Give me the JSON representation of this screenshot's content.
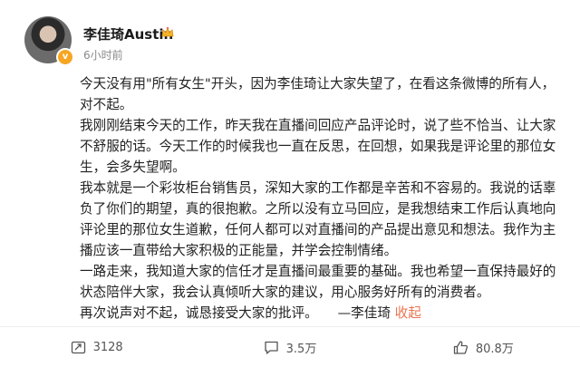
{
  "header": {
    "username": "李佳琦Austin",
    "timestamp": "6小时前",
    "badge_icon": "verified-v-icon",
    "crown_icon": "crown-icon",
    "more_icon": "more-options-icon"
  },
  "post": {
    "paragraphs": [
      "今天没有用\"所有女生\"开头，因为李佳琦让大家失望了，在看这条微博的所有人，对不起。",
      "我刚刚结束今天的工作，昨天我在直播间回应产品评论时，说了些不恰当、让大家不舒服的话。今天工作的时候我也一直在反思，在回想，如果我是评论里的那位女生，会多失望啊。",
      "我本就是一个彩妆柜台销售员，深知大家的工作都是辛苦和不容易的。我说的话辜负了你们的期望，真的很抱歉。之所以没有立马回应，是我想结束工作后认真地向评论里的那位女生道歉，任何人都可以对直播间的产品提出意见和想法。我作为主播应该一直带给大家积极的正能量，并学会控制情绪。",
      "一路走来，我知道大家的信任才是直播间最重要的基础。我也希望一直保持最好的状态陪伴大家，我会认真倾听大家的建议，用心服务好所有的消费者。"
    ],
    "last_line": "再次说声对不起，诚恳接受大家的批评。　　—李佳琦",
    "collapse_label": "收起"
  },
  "footer": {
    "repost_count": "3128",
    "comment_count": "3.5万",
    "like_count": "80.8万",
    "repost_icon": "repost-icon",
    "comment_icon": "comment-icon",
    "like_icon": "like-icon"
  },
  "colors": {
    "accent_link": "#eb7350",
    "badge": "#f6a623",
    "text": "#222222",
    "meta": "#8a8a8a"
  }
}
